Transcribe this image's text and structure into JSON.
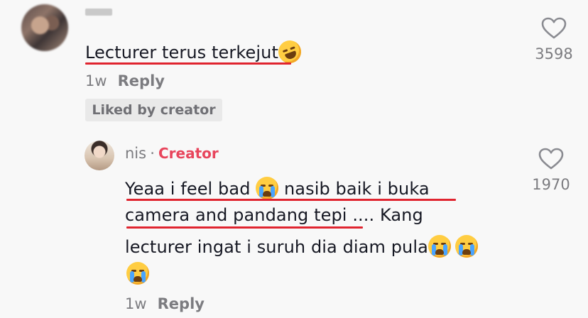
{
  "comment1": {
    "text": "Lecturer terus terkejut",
    "emoji": "rolling-on-floor-laughing",
    "time": "1w",
    "reply_label": "Reply",
    "liked_badge": "Liked by creator",
    "likes": "3598"
  },
  "reply1": {
    "username": "nis",
    "separator": "·",
    "creator_label": "Creator",
    "line1_a": "Yeaa i feel bad",
    "line1_b": "nasib baik i buka",
    "line2_a": "camera and pandang tepi",
    "line2_b": ".... Kang",
    "line3": "lecturer ingat i suruh dia diam pula",
    "emoji": "loudly-crying-face",
    "time": "1w",
    "reply_label": "Reply",
    "likes": "1970"
  },
  "colors": {
    "underline": "#e0242f",
    "creator": "#e8455c",
    "muted": "#7c7c80"
  }
}
